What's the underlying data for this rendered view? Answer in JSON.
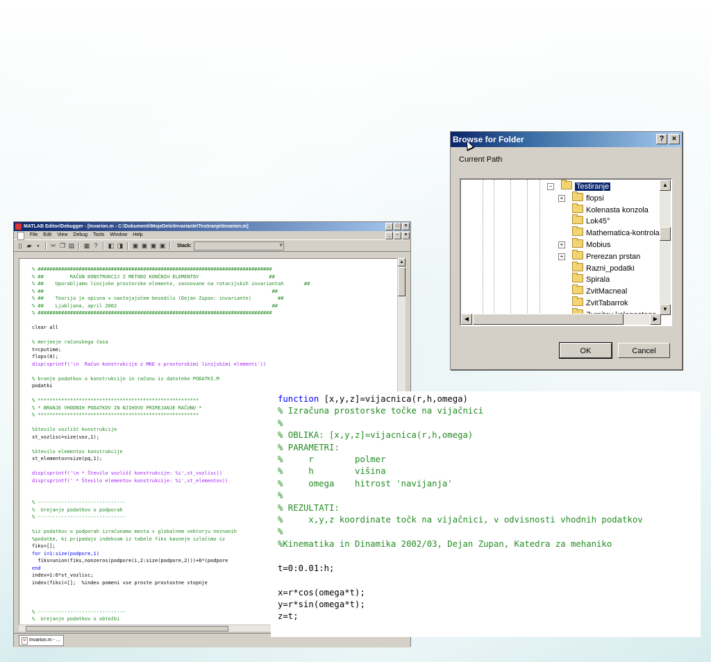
{
  "editor": {
    "title": "MATLAB Editor/Debugger - [Invarion.m - C:\\Dokumenti\\MojeDelo\\Invariante\\Testiranje\\Invarion.m]",
    "menu": [
      "File",
      "Edit",
      "View",
      "Debug",
      "Tools",
      "Window",
      "Help"
    ],
    "stack_label": "Stack:",
    "tab_label": "Invarion.m - ..."
  },
  "dialog": {
    "title": "Browse for Folder",
    "current_path_label": "Current Path",
    "tree": [
      {
        "label": "Testiranje",
        "selected": true,
        "expander": "minus"
      },
      {
        "label": "flopsi",
        "expander": "plus"
      },
      {
        "label": "Kolenasta konzola"
      },
      {
        "label": "Lok45°"
      },
      {
        "label": "Mathematica-kontrola"
      },
      {
        "label": "Mobius",
        "expander": "plus"
      },
      {
        "label": "Prerezan prstan",
        "expander": "plus"
      },
      {
        "label": "Razni_podatki"
      },
      {
        "label": "Spirala"
      },
      {
        "label": "ZvitMacneal"
      },
      {
        "label": "ZvitTabarrok"
      },
      {
        "label": "Zvrnitev kolenastega"
      }
    ],
    "ok_label": "OK",
    "cancel_label": "Cancel"
  },
  "overlay_lines": [
    {
      "text": "function [x,y,z]=vijacnica(r,h,omega)",
      "kind": "fn"
    },
    {
      "text": "% Izračuna prostorske točke na vijačnici",
      "kind": "c"
    },
    {
      "text": "%",
      "kind": "c"
    },
    {
      "text": "% OBLIKA: [x,y,z]=vijacnica(r,h,omega)",
      "kind": "c"
    },
    {
      "text": "% PARAMETRI:",
      "kind": "c"
    },
    {
      "text": "%     r        polmer",
      "kind": "c"
    },
    {
      "text": "%     h        višina",
      "kind": "c"
    },
    {
      "text": "%     omega    hitrost 'navijanja'",
      "kind": "c"
    },
    {
      "text": "%",
      "kind": "c"
    },
    {
      "text": "% REZULTATI:",
      "kind": "c"
    },
    {
      "text": "%     x,y,z koordinate točk na vijačnici, v odvisnosti vhodnih podatkov",
      "kind": "c"
    },
    {
      "text": "%",
      "kind": "c"
    },
    {
      "text": "%Kinematika in Dinamika 2002/03, Dejan Zupan, Katedra za mehaniko",
      "kind": "c"
    },
    {
      "text": "",
      "kind": "p"
    },
    {
      "text": "t=0:0.01:h;",
      "kind": "p"
    },
    {
      "text": "",
      "kind": "p"
    },
    {
      "text": "x=r*cos(omega*t);",
      "kind": "p"
    },
    {
      "text": "y=r*sin(omega*t);",
      "kind": "p"
    },
    {
      "text": "z=t;",
      "kind": "p"
    }
  ],
  "editor_lines": [
    {
      "text": "% ################################################################################",
      "kind": "c"
    },
    {
      "text": "% ##         RAČUN KONSTRUKCIJ Z METODO KONČNIH ELEMENTOV                        ##",
      "kind": "c"
    },
    {
      "text": "% ##    Uporabljamo linijske prostorske elemente, zasnovane na rotacijskih invariantah       ##",
      "kind": "c"
    },
    {
      "text": "% ##                                                                              ##",
      "kind": "c"
    },
    {
      "text": "% ##    Teorija je opisna v nastajajočem besedilu (Dejan Zupan: invariante)         ##",
      "kind": "c"
    },
    {
      "text": "% ##    Ljubljana, april 2002                                                     ##",
      "kind": "c"
    },
    {
      "text": "% ################################################################################",
      "kind": "c"
    },
    {
      "text": "",
      "kind": "p"
    },
    {
      "text": "clear all",
      "kind": "p"
    },
    {
      "text": "",
      "kind": "p"
    },
    {
      "text": "% merjenje računskega časa",
      "kind": "c"
    },
    {
      "text": "t=cputime;",
      "kind": "p"
    },
    {
      "text": "flops(0);",
      "kind": "p"
    },
    {
      "text": "disp(sprintf('\\n  Račun konstrukcije z MKE s prostorskimi linijskimi elementi'))",
      "kind": "s"
    },
    {
      "text": "",
      "kind": "p"
    },
    {
      "text": "% branje podatkov o konstrukcije in računu iz datoteke PODATKI.M",
      "kind": "c"
    },
    {
      "text": "podatki",
      "kind": "p"
    },
    {
      "text": "",
      "kind": "p"
    },
    {
      "text": "% *******************************************************",
      "kind": "c"
    },
    {
      "text": "% * BRANJE VHODNIH PODATKOV IN NJIHOVO PRIREJANJE RAČUNU *",
      "kind": "c"
    },
    {
      "text": "% *******************************************************",
      "kind": "c"
    },
    {
      "text": "",
      "kind": "p"
    },
    {
      "text": "%število vozlišč konstrukcije",
      "kind": "c"
    },
    {
      "text": "st_vozlisc=size(voz,1);",
      "kind": "p"
    },
    {
      "text": "",
      "kind": "p"
    },
    {
      "text": "%število elementov konstrukcije",
      "kind": "c"
    },
    {
      "text": "st_elementov=size(pq,1);",
      "kind": "p"
    },
    {
      "text": "",
      "kind": "p"
    },
    {
      "text": "disp(sprintf('\\n * Število vozlišč konstrukcije: %i',st_vozlisc))",
      "kind": "s"
    },
    {
      "text": "disp(sprintf(' * Število elementov konstrukcije: %i',st_elementov))",
      "kind": "s"
    },
    {
      "text": "",
      "kind": "p"
    },
    {
      "text": "",
      "kind": "p"
    },
    {
      "text": "% ------------------------------",
      "kind": "c"
    },
    {
      "text": "%  Urejanje podatkov o podporah",
      "kind": "c"
    },
    {
      "text": "% ------------------------------",
      "kind": "c"
    },
    {
      "text": "",
      "kind": "p"
    },
    {
      "text": "%iz podatkov o podporah izračunamo mesta v globalnem vektorju neznanih",
      "kind": "c"
    },
    {
      "text": "%podatke, ki pripadajo indeksom iz tabele fiks kasneje izločimo iz",
      "kind": "c"
    },
    {
      "text": "fiks=[];",
      "kind": "p"
    },
    {
      "text": "for i=1:size(podpore,1)",
      "kind": "k"
    },
    {
      "text": "  fiks=union(fiks,nonzeros(podpore(i,2:size(podpore,2)))+6*(podpore",
      "kind": "p"
    },
    {
      "text": "end",
      "kind": "k"
    },
    {
      "text": "index=1:6*st_vozlisc;",
      "kind": "p"
    },
    {
      "text": "index(fiks)=[];  %index pomeni vse proste prostostne stopnje",
      "kind": "p"
    },
    {
      "text": "",
      "kind": "p"
    },
    {
      "text": "",
      "kind": "p"
    },
    {
      "text": "",
      "kind": "p"
    },
    {
      "text": "% ------------------------------",
      "kind": "c"
    },
    {
      "text": "%  Urejanje podatkov o obtežbi",
      "kind": "c"
    }
  ]
}
